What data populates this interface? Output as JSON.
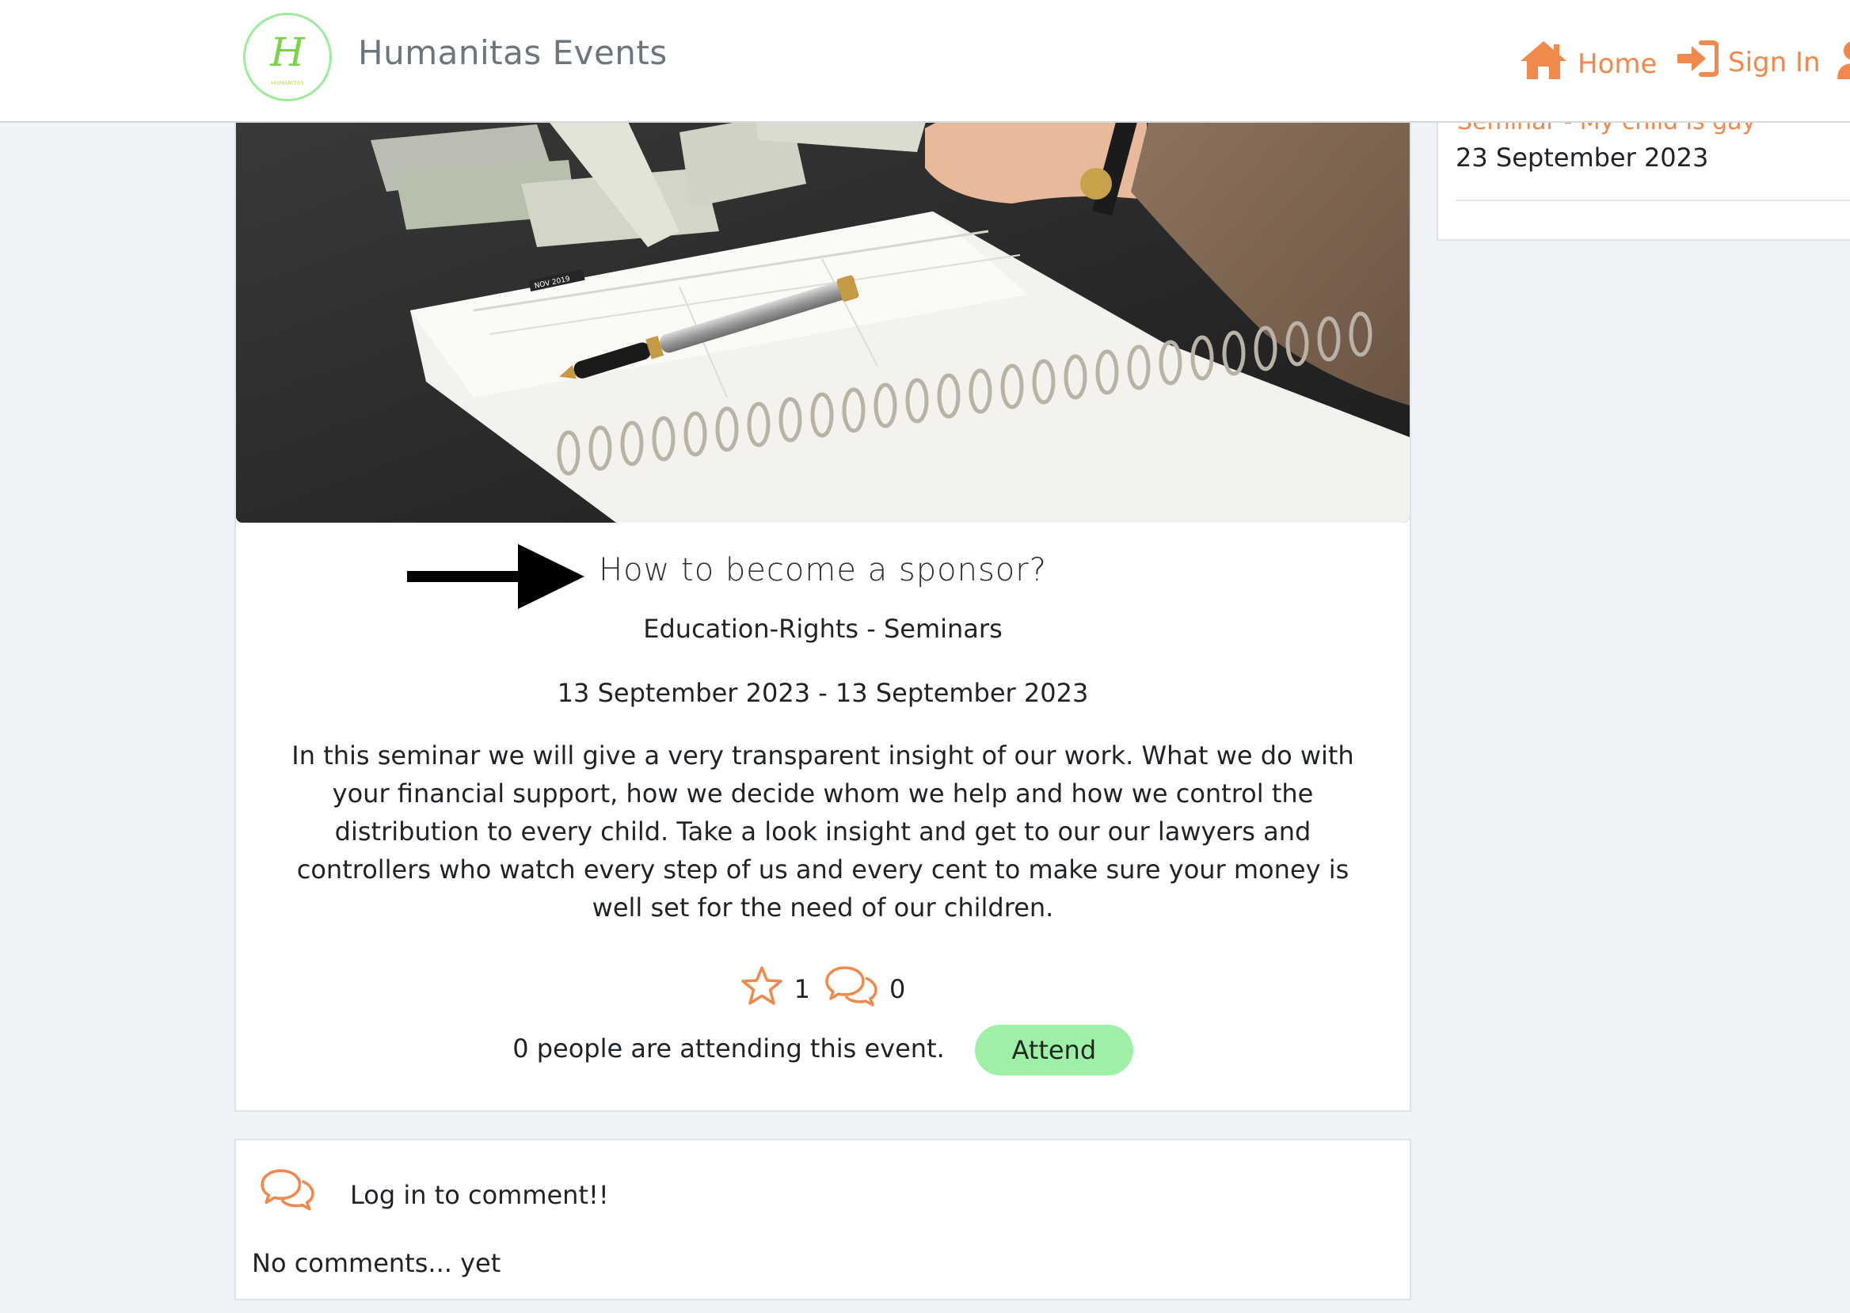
{
  "navbar": {
    "brand": "Humanitas Events",
    "logo_letter": "H",
    "logo_caption": "HUMANITAS",
    "home_label": "Home",
    "signin_label": "Sign In"
  },
  "sidebar": {
    "event_title": "Seminar - My child is gay",
    "event_date": "23 September 2023"
  },
  "event": {
    "title": "How to become a sponsor?",
    "category": "Education-Rights - Seminars",
    "dates": "13 September 2023 - 13 September 2023",
    "description": "In this seminar we will give a very transparent insight of our work. What we do with your financial support, how we decide whom we help and how we control the distribution to every child. Take a look insight and get to our our lawyers and controllers who watch every step of us and every cent to make sure your money is well set for the need of our children.",
    "favorites_count": "1",
    "comments_count": "0",
    "attending_text": "0 people are attending this event.",
    "attend_label": "Attend",
    "hero_notebook_tab": "NOV 2019"
  },
  "comments": {
    "login_prompt": "Log in to comment!!",
    "empty_text": "No comments... yet"
  },
  "colors": {
    "accent": "#f0894b",
    "attend_button": "#9ef0a6",
    "page_bg": "#eff3f7",
    "logo_ring": "#9bed9b"
  },
  "icons": [
    "home-icon",
    "sign-in-icon",
    "user-icon",
    "star-icon",
    "comments-icon",
    "arrow-right-icon"
  ]
}
